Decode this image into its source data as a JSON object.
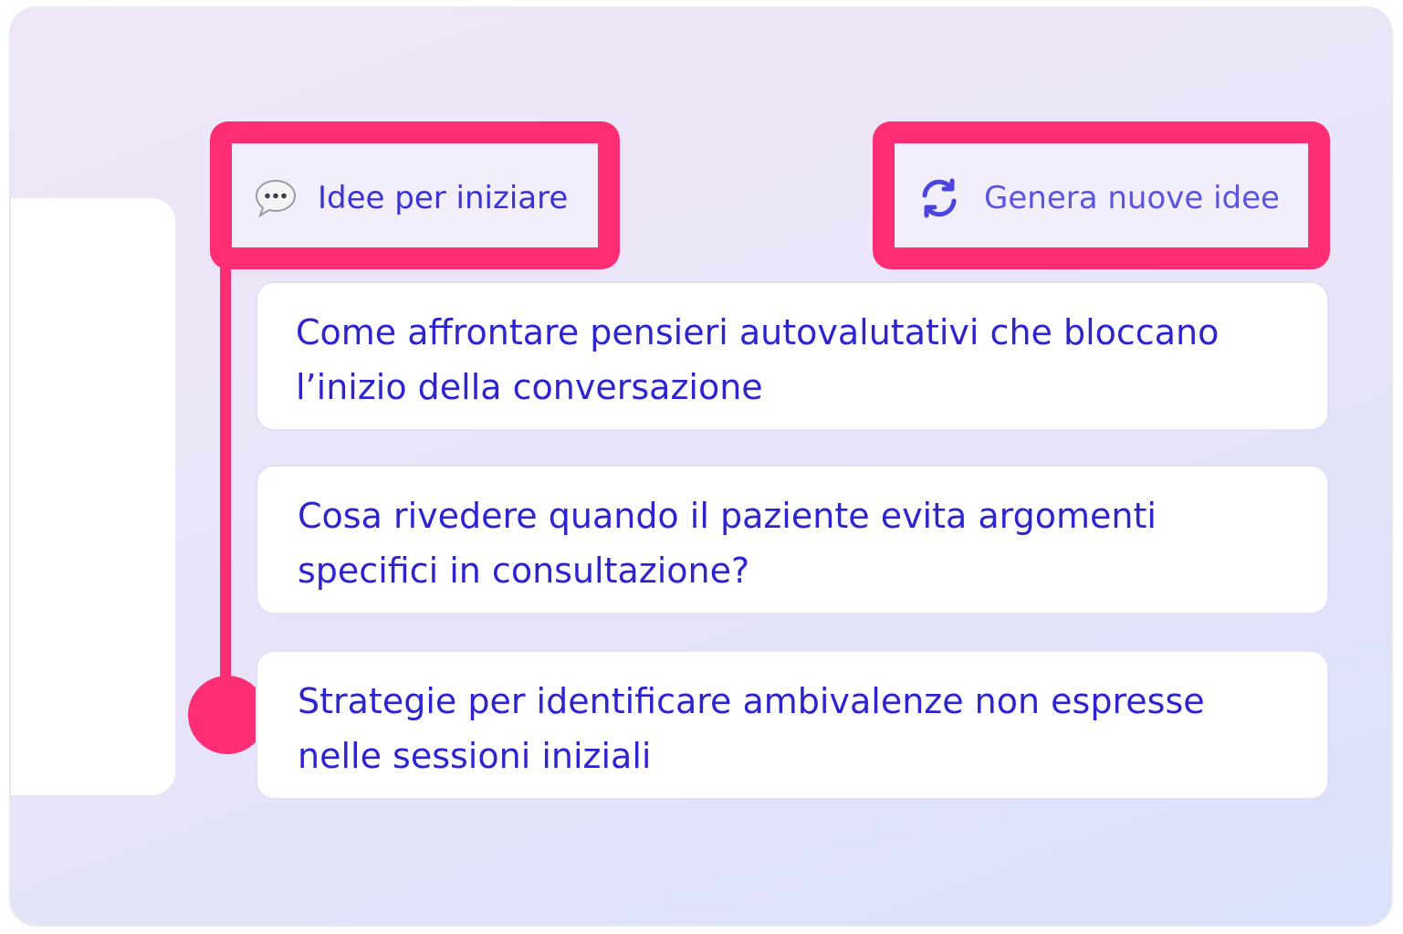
{
  "header": {
    "start_label": "Idee per iniziare",
    "start_icon": "speech-bubble-icon",
    "regenerate_label": "Genera nuove idee",
    "regenerate_icon": "refresh-icon"
  },
  "suggestions": [
    {
      "text": "Come affrontare pensieri autovalutativi che bloccano l’inizio della conversazione"
    },
    {
      "text": "Cosa rivedere quando il paziente evita argomenti specifici in consultazione?"
    },
    {
      "text": "Strategie per identificare ambivalenze non espresse nelle sessioni iniziali"
    }
  ],
  "colors": {
    "highlight": "#ff2d74",
    "text": "#2d24cf",
    "accent": "#5a55e0"
  }
}
